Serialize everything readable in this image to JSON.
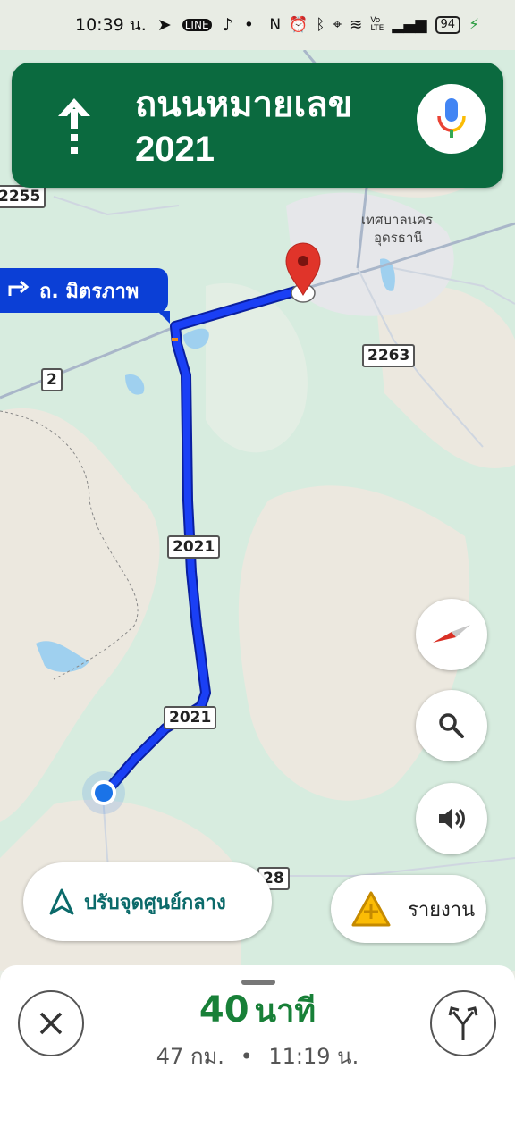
{
  "status_bar": {
    "time": "10:39 น.",
    "battery": "94"
  },
  "nav_banner": {
    "street_line1": "ถนนหมายเลข",
    "street_line2": "2021"
  },
  "next_turn": {
    "label": "ถ. มิตรภาพ"
  },
  "map": {
    "town_name_line1": "เทศบาลนคร",
    "town_name_line2": "อุดรธานี",
    "shields": {
      "s2255": "2255",
      "s2": "2",
      "s2263": "2263",
      "s2021a": "2021",
      "s2021b": "2021",
      "s28": "28"
    }
  },
  "recenter_button": {
    "label": "ปรับจุดศูนย์กลาง"
  },
  "report_button": {
    "label": "รายงาน"
  },
  "trip": {
    "duration_value": "40",
    "duration_unit": "นาที",
    "distance": "47 กม.",
    "separator": "•",
    "arrival": "11:19 น."
  },
  "colors": {
    "banner_green": "#0b6a3f",
    "route_blue": "#1a3ff5",
    "eta_green": "#188038"
  },
  "icons": [
    "up-arrow-icon",
    "mic-icon",
    "turn-right-icon",
    "compass-icon",
    "search-icon",
    "volume-icon",
    "navigation-arrow-icon",
    "report-warning-icon",
    "close-icon",
    "route-options-icon"
  ]
}
